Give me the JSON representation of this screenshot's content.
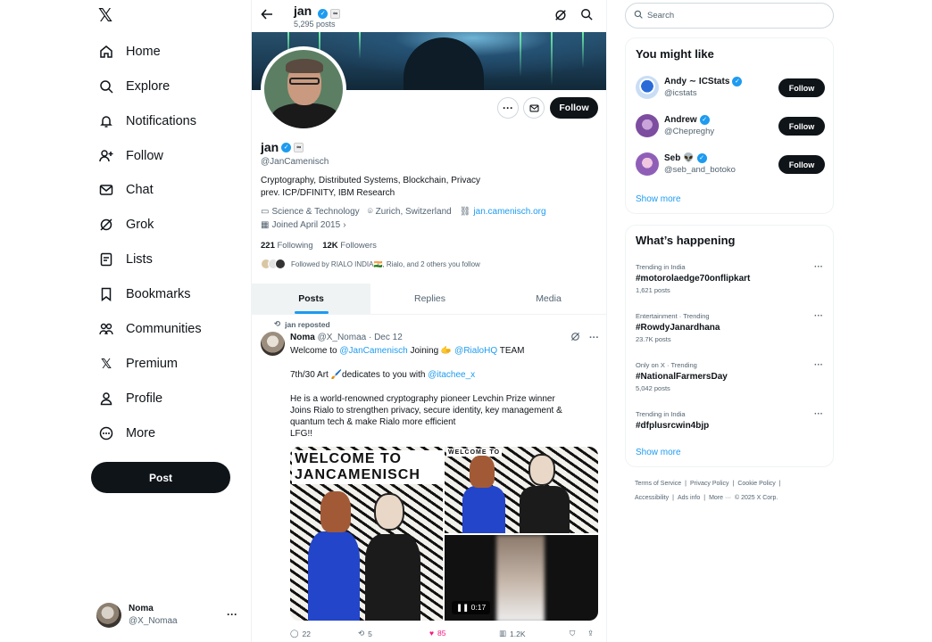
{
  "nav": {
    "logo": "𝕏",
    "items": [
      {
        "label": "Home",
        "icon": "home-icon"
      },
      {
        "label": "Explore",
        "icon": "search-icon"
      },
      {
        "label": "Notifications",
        "icon": "bell-icon"
      },
      {
        "label": "Follow",
        "icon": "person-add-icon"
      },
      {
        "label": "Chat",
        "icon": "mail-icon"
      },
      {
        "label": "Grok",
        "icon": "grok-icon"
      },
      {
        "label": "Lists",
        "icon": "list-icon"
      },
      {
        "label": "Bookmarks",
        "icon": "bookmark-icon"
      },
      {
        "label": "Communities",
        "icon": "communities-icon"
      },
      {
        "label": "Premium",
        "icon": "x-logo-icon"
      },
      {
        "label": "Profile",
        "icon": "person-icon"
      },
      {
        "label": "More",
        "icon": "more-circle-icon"
      }
    ],
    "post_label": "Post",
    "account": {
      "name": "Noma",
      "handle": "@X_Nomaa",
      "menu": "···"
    }
  },
  "header": {
    "title": "jan",
    "posts_count": "5,295 posts"
  },
  "profile": {
    "name": "jan",
    "handle": "@JanCamenisch",
    "follow_label": "Follow",
    "more_label": "···",
    "bio_line1": "Cryptography, Distributed Systems, Blockchain, Privacy",
    "bio_line2": "prev. ICP/DFINITY, IBM Research",
    "category": "Science & Technology",
    "location": "Zurich, Switzerland",
    "website": "jan.camenisch.org",
    "joined": "Joined April 2015",
    "following_count": "221",
    "following_label": "Following",
    "followers_count": "12K",
    "followers_label": "Followers",
    "followed_by": "Followed by RIALO INDIA🇮🇳, Rialo, and 2 others you follow"
  },
  "tabs": [
    {
      "label": "Posts",
      "active": true
    },
    {
      "label": "Replies",
      "active": false
    },
    {
      "label": "Media",
      "active": false
    }
  ],
  "tweet": {
    "repost_label": "jan reposted",
    "author_name": "Noma",
    "author_meta": "@X_Nomaa · Dec 12",
    "line1_a": "Welcome to ",
    "line1_mention1": "@JanCamenisch",
    "line1_b": " Joining 🫱 ",
    "line1_mention2": "@RialoHQ",
    "line1_c": " TEAM",
    "line2_a": "7th/30 Art 🖌️dedicates to you with ",
    "line2_mention": "@itachee_x",
    "line3": "He is a world-renowned cryptography pioneer Levchin Prize winner",
    "line4": "Joins Rialo to strengthen privacy, secure identity, key management &",
    "line5": "quantum tech & make Rialo more efficient",
    "line6": "LFG!!",
    "mural_text": "WELCOME TO JANCAMENISCH",
    "mural_small": "WELCOME TO",
    "mural_small2": "JANCAMENISCH",
    "video_time": "0:17",
    "replies": "22",
    "reposts": "5",
    "likes": "85",
    "views": "1.2K"
  },
  "right": {
    "search_placeholder": "Search",
    "wtf_title": "You might like",
    "wtf": [
      {
        "name": "Andy ∼ ICStats",
        "handle": "@icstats",
        "follow": "Follow"
      },
      {
        "name": "Andrew",
        "handle": "@Chepreghy",
        "follow": "Follow"
      },
      {
        "name": "Seb 👽",
        "handle": "@seb_and_botoko",
        "follow": "Follow"
      }
    ],
    "show_more": "Show more",
    "trends_title": "What’s happening",
    "trends": [
      {
        "context": "Trending in India",
        "title": "#motorolaedge70onflipkart",
        "posts": "1,621 posts"
      },
      {
        "context": "Entertainment · Trending",
        "title": "#RowdyJanardhana",
        "posts": "23.7K posts"
      },
      {
        "context": "Only on X · Trending",
        "title": "#NationalFarmersDay",
        "posts": "5,042 posts"
      },
      {
        "context": "Trending in India",
        "title": "#dfplusrcwin4bjp",
        "posts": ""
      }
    ],
    "trends_show_more": "Show more",
    "footer_line1": [
      "Terms of Service",
      "|",
      "Privacy Policy",
      "|",
      "Cookie Policy",
      "|"
    ],
    "footer_line2": [
      "Accessibility",
      "|",
      "Ads info",
      "|",
      "More ···",
      "© 2025 X Corp."
    ]
  },
  "colors": {
    "accent": "#1d9bf0",
    "text": "#0f1419",
    "muted": "#536471",
    "like": "#f91880"
  }
}
